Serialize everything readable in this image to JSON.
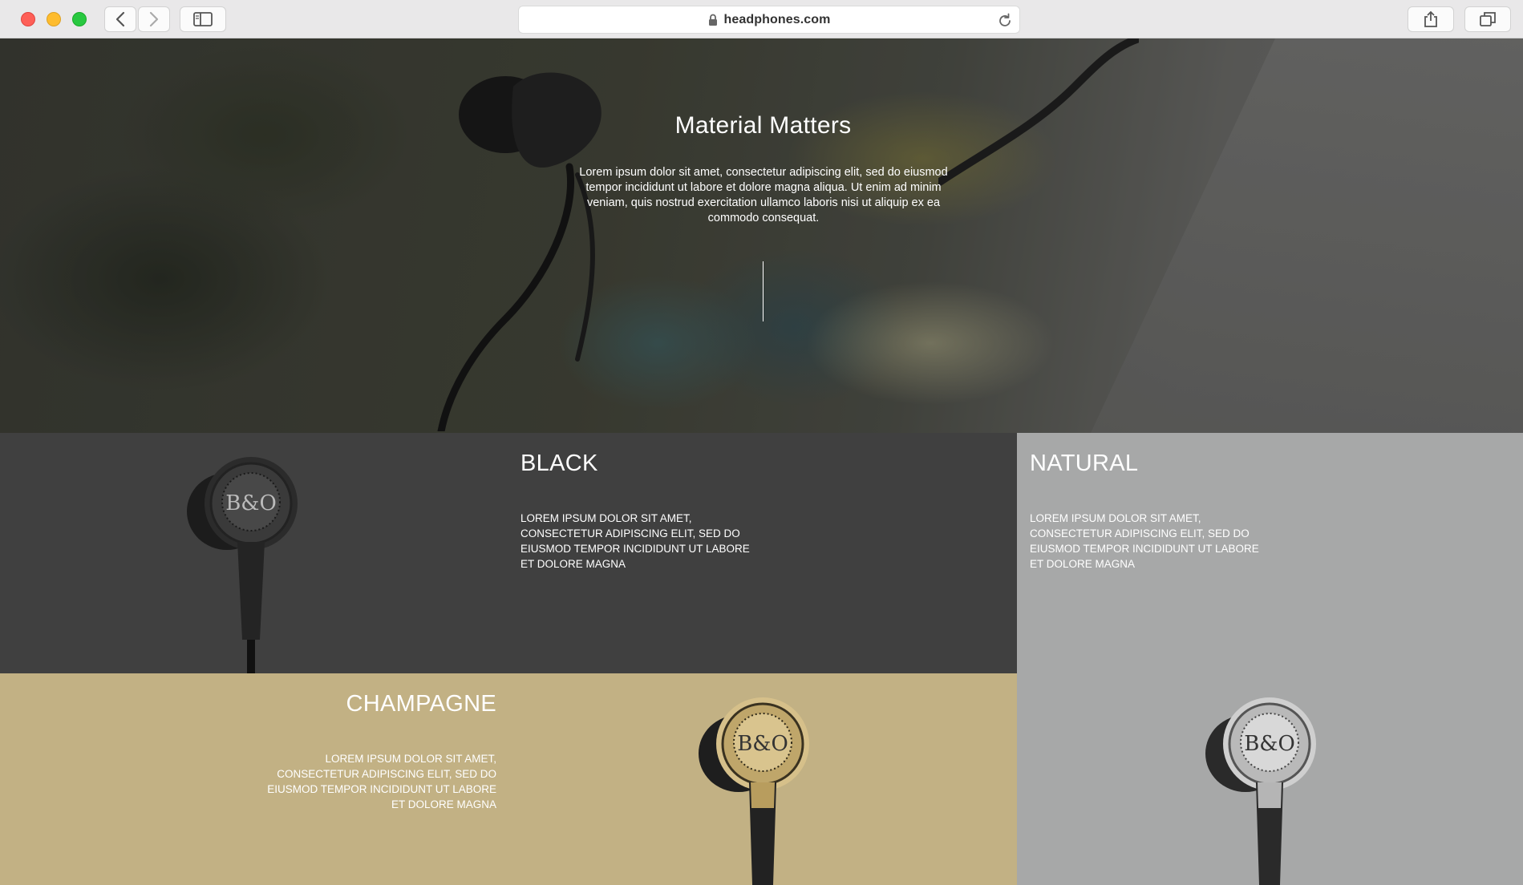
{
  "browser": {
    "url": "headphones.com",
    "icons": {
      "back": "chevron-left-icon",
      "forward": "chevron-right-icon",
      "sidebar": "sidebar-icon",
      "lock": "lock-icon",
      "reload": "reload-icon",
      "share": "share-icon",
      "tabs": "tabs-icon"
    }
  },
  "hero": {
    "title": "Material Matters",
    "body": "Lorem ipsum dolor sit amet, consectetur adipiscing elit, sed do eiusmod tempor incididunt ut labore et dolore magna aliqua. Ut enim ad minim veniam, quis nostrud exercitation ullamco laboris nisi ut aliquip ex ea commodo consequat."
  },
  "variants": {
    "black": {
      "title": "BLACK",
      "body": "LOREM IPSUM DOLOR SIT AMET, CONSECTETUR ADIPISCING ELIT, SED DO EIUSMOD TEMPOR INCIDIDUNT UT LABORE ET DOLORE MAGNA",
      "color": "#404040"
    },
    "natural": {
      "title": "NATURAL",
      "body": "LOREM IPSUM DOLOR SIT AMET, CONSECTETUR ADIPISCING ELIT, SED DO EIUSMOD TEMPOR INCIDIDUNT UT LABORE ET DOLORE MAGNA",
      "color": "#a7a8a8"
    },
    "champagne": {
      "title": "CHAMPAGNE",
      "body": "LOREM IPSUM DOLOR SIT AMET, CONSECTETUR ADIPISCING ELIT, SED DO EIUSMOD TEMPOR INCIDIDUNT UT LABORE ET DOLORE MAGNA",
      "color": "#c2b184"
    }
  },
  "colors": {
    "traffic_red": "#fe5f57",
    "traffic_yellow": "#febc2e",
    "traffic_green": "#28c840"
  }
}
